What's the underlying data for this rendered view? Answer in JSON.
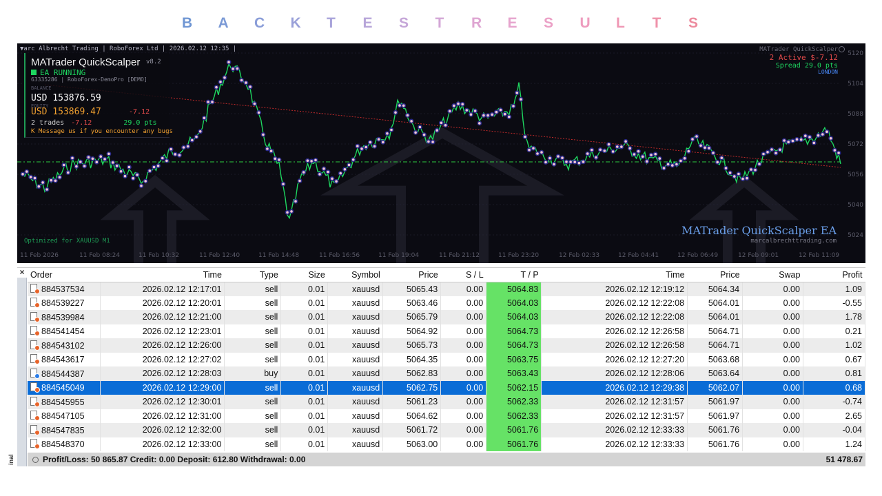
{
  "title": {
    "letters": [
      "B",
      "A",
      "C",
      "K",
      "T",
      "E",
      "S",
      "T",
      "R",
      "E",
      "S",
      "U",
      "L",
      "T",
      "S"
    ],
    "colors": [
      "#6f96d3",
      "#7b9ad6",
      "#8a9dd8",
      "#99a0d9",
      "#a8a3da",
      "#b7a5d9",
      "#c5a6d8",
      "#d3a6d6",
      "#dea5d2",
      "#e6a3cd",
      "#eba0c6",
      "#ee9cbe",
      "#ef97b4",
      "#ef91a9",
      "#ed8b9e"
    ]
  },
  "chart": {
    "topbar": "▼arc Albrecht Trading  |  RoboForex Ltd  |  2026.02.12 12:35  |",
    "info": {
      "name": "MATrader QuickScalper",
      "version": "v8.2",
      "status": "EA RUNNING",
      "account": "63335286  |  RoboForex-DemoPro  [DEMO]",
      "balance_caption": "BALANCE",
      "balance": "USD  153876.59",
      "equity_caption": "EQUITY",
      "equity": "USD  153869.47",
      "equity_delta": "-7.12",
      "trades_count": "2 trades",
      "trades_pl": "-7.12",
      "trades_pts": "29.0 pts",
      "message": "K Message us if you encounter any bugs\\n(Telegr"
    },
    "right": {
      "name": "MATrader QuickScalper",
      "active": "2 Active  $-7.12",
      "spread": "Spread 29.0 pts",
      "session": "LONDON"
    },
    "brand": "MATrader QuickScalper EA",
    "url": "marcalbrechttrading.com",
    "optimized": "Optimized for XAUUSD M1",
    "y_labels": [
      "5120",
      "5104",
      "5088",
      "5072",
      "5056",
      "5040",
      "5024"
    ],
    "x_labels": [
      "11 Feb 2026",
      "11 Feb 08:24",
      "11 Feb 10:32",
      "11 Feb 12:40",
      "11 Feb 14:48",
      "11 Feb 16:56",
      "11 Feb 19:04",
      "11 Feb 21:12",
      "11 Feb 23:20",
      "12 Feb 02:33",
      "12 Feb 04:41",
      "12 Feb 06:49",
      "12 Feb 09:01",
      "12 Feb 11:09"
    ],
    "colors": {
      "bg": "#0b0b12",
      "candle": "#1ed760",
      "dots": "#f2c6d4",
      "dot_outline": "#2a2a88",
      "trend": "#c02a2a",
      "level": "#2ecc40"
    }
  },
  "table": {
    "columns": [
      "Order",
      "Time",
      "Type",
      "Size",
      "Symbol",
      "Price",
      "S / L",
      "T / P",
      "Time",
      "Price",
      "Swap",
      "Profit"
    ],
    "rows": [
      [
        "884537534",
        "2026.02.12 12:17:01",
        "sell",
        "0.01",
        "xauusd",
        "5065.43",
        "0.00",
        "5064.83",
        "2026.02.12 12:19:12",
        "5064.34",
        "0.00",
        "1.09"
      ],
      [
        "884539227",
        "2026.02.12 12:20:01",
        "sell",
        "0.01",
        "xauusd",
        "5063.46",
        "0.00",
        "5064.03",
        "2026.02.12 12:22:08",
        "5064.01",
        "0.00",
        "-0.55"
      ],
      [
        "884539984",
        "2026.02.12 12:21:00",
        "sell",
        "0.01",
        "xauusd",
        "5065.79",
        "0.00",
        "5064.03",
        "2026.02.12 12:22:08",
        "5064.01",
        "0.00",
        "1.78"
      ],
      [
        "884541454",
        "2026.02.12 12:23:01",
        "sell",
        "0.01",
        "xauusd",
        "5064.92",
        "0.00",
        "5064.73",
        "2026.02.12 12:26:58",
        "5064.71",
        "0.00",
        "0.21"
      ],
      [
        "884543102",
        "2026.02.12 12:26:00",
        "sell",
        "0.01",
        "xauusd",
        "5065.73",
        "0.00",
        "5064.73",
        "2026.02.12 12:26:58",
        "5064.71",
        "0.00",
        "1.02"
      ],
      [
        "884543617",
        "2026.02.12 12:27:02",
        "sell",
        "0.01",
        "xauusd",
        "5064.35",
        "0.00",
        "5063.75",
        "2026.02.12 12:27:20",
        "5063.68",
        "0.00",
        "0.67"
      ],
      [
        "884544387",
        "2026.02.12 12:28:03",
        "buy",
        "0.01",
        "xauusd",
        "5062.83",
        "0.00",
        "5063.43",
        "2026.02.12 12:28:06",
        "5063.64",
        "0.00",
        "0.81"
      ],
      [
        "884545049",
        "2026.02.12 12:29:00",
        "sell",
        "0.01",
        "xauusd",
        "5062.75",
        "0.00",
        "5062.15",
        "2026.02.12 12:29:38",
        "5062.07",
        "0.00",
        "0.68"
      ],
      [
        "884545955",
        "2026.02.12 12:30:01",
        "sell",
        "0.01",
        "xauusd",
        "5061.23",
        "0.00",
        "5062.33",
        "2026.02.12 12:31:57",
        "5061.97",
        "0.00",
        "-0.74"
      ],
      [
        "884547105",
        "2026.02.12 12:31:00",
        "sell",
        "0.01",
        "xauusd",
        "5064.62",
        "0.00",
        "5062.33",
        "2026.02.12 12:31:57",
        "5061.97",
        "0.00",
        "2.65"
      ],
      [
        "884547835",
        "2026.02.12 12:32:00",
        "sell",
        "0.01",
        "xauusd",
        "5061.72",
        "0.00",
        "5061.76",
        "2026.02.12 12:33:33",
        "5061.76",
        "0.00",
        "-0.04"
      ],
      [
        "884548370",
        "2026.02.12 12:33:00",
        "sell",
        "0.01",
        "xauusd",
        "5063.00",
        "0.00",
        "5061.76",
        "2026.02.12 12:33:33",
        "5061.76",
        "0.00",
        "1.24"
      ]
    ],
    "selected_row": 7,
    "footer": {
      "summary": "Profit/Loss: 50 865.87  Credit: 0.00  Deposit: 612.80  Withdrawal: 0.00",
      "total": "51 478.67"
    },
    "sidebar_label": "inal",
    "close": "×"
  }
}
